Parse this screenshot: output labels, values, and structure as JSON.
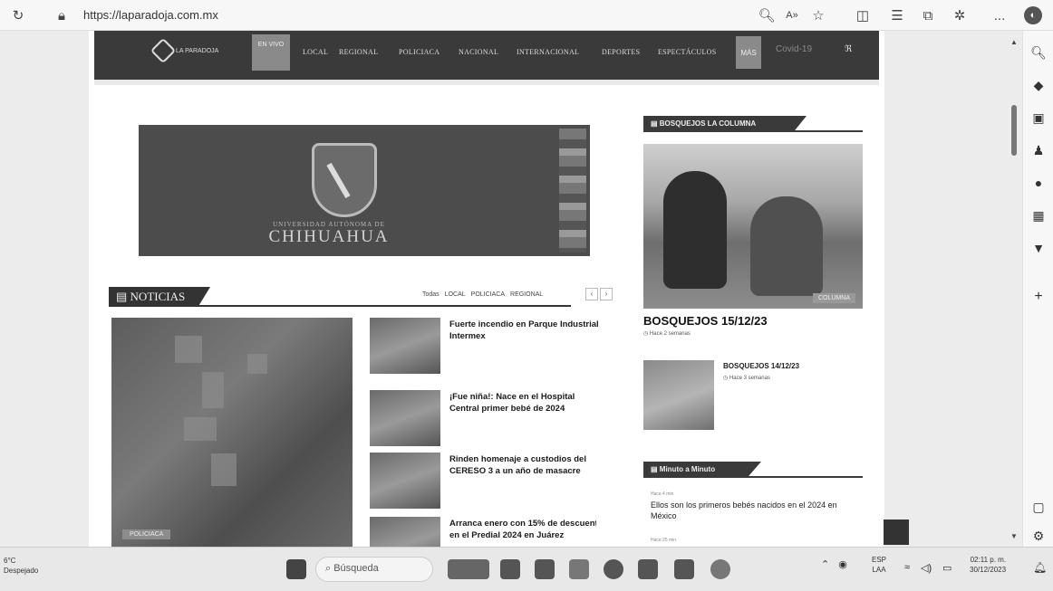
{
  "browser": {
    "url": "https://laparadoja.com.mx",
    "icons": [
      "refresh-icon",
      "lock-icon",
      "zoom-icon",
      "read-aloud-icon",
      "favorite-icon",
      "split-screen-icon",
      "favorites-list-icon",
      "collections-icon",
      "extensions-icon",
      "more-icon",
      "copilot-icon"
    ],
    "more_label": "..."
  },
  "sidebar": {
    "icons": [
      "search-icon",
      "tag-icon",
      "shopping-icon",
      "games-icon",
      "office-icon",
      "outlook-icon",
      "tools-icon",
      "add-icon",
      "sidebar-toggle-icon",
      "settings-icon"
    ]
  },
  "site": {
    "logo_text": "LA PARADOJA",
    "en_vivo": "EN VIVO",
    "nav": [
      "LOCAL",
      "REGIONAL",
      "POLICIACA",
      "NACIONAL",
      "INTERNACIONAL",
      "DEPORTES",
      "ESPECTÁCULOS"
    ],
    "more": "MÁS",
    "covid": "Covid-19",
    "rss": "RSS"
  },
  "banner": {
    "sub": "UNIVERSIDAD AUTÓNOMA DE",
    "main": "CHIHUAHUA"
  },
  "noticias": {
    "title": "NOTICIAS",
    "tabs": [
      "Todas",
      "LOCAL",
      "POLICIACA",
      "REGIONAL"
    ],
    "main_tag": "POLICIACA",
    "items": [
      {
        "title": "Fuerte incendio en Parque Industrial Intermex"
      },
      {
        "title": "¡Fue niña!: Nace en el Hospital Central primer bebé de 2024"
      },
      {
        "title": "Rinden homenaje a custodios del CERESO 3 a un año de masacre"
      },
      {
        "title": "Arranca enero con 15% de descuento en el Predial 2024 en Juárez"
      }
    ]
  },
  "bosquejos": {
    "header": "BOSQUEJOS LA COLUMNA",
    "photo_tag": "COLUMNA",
    "title": "BOSQUEJOS 15/12/23",
    "time": "Hace 2 semanas",
    "item2_title": "BOSQUEJOS 14/12/23",
    "item2_time": "Hace 3 semanas"
  },
  "minuto": {
    "header": "Minuto a Minuto",
    "time1": "Hace 4 min",
    "item1": "Ellos son los primeros bebés nacidos en el 2024 en México",
    "time2": "Hace 25 min"
  },
  "taskbar": {
    "temp": "6°C",
    "weather": "Despejado",
    "search_placeholder": "Búsqueda",
    "lang1": "ESP",
    "lang2": "LAA",
    "time": "02:11 p. m.",
    "date": "30/12/2023"
  }
}
